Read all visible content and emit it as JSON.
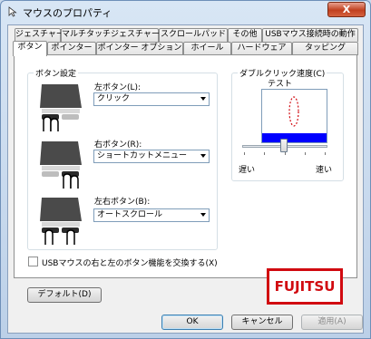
{
  "window": {
    "title": "マウスのプロパティ",
    "close_glyph": "X"
  },
  "tabs": {
    "row1": [
      "ジェスチャー",
      "マルチタッチジェスチャー",
      "スクロールパッド",
      "その他",
      "USBマウス接続時の動作"
    ],
    "row2": [
      "ボタン",
      "ポインター",
      "ポインター オプション",
      "ホイール",
      "ハードウェア",
      "タッピング"
    ],
    "active": "ボタン"
  },
  "button_settings": {
    "group_label": "ボタン設定",
    "left": {
      "label": "左ボタン(L):",
      "value": "クリック"
    },
    "right": {
      "label": "右ボタン(R):",
      "value": "ショートカットメニュー"
    },
    "both": {
      "label": "左右ボタン(B):",
      "value": "オートスクロール"
    }
  },
  "double_click": {
    "group_label": "ダブルクリック速度(C)",
    "test_label": "テスト",
    "slow_label": "遅い",
    "fast_label": "速い",
    "speed_level": 0.7
  },
  "swap_checkbox": {
    "label": "USBマウスの右と左のボタン機能を交換する(X)",
    "checked": false
  },
  "default_button": "デフォルト(D)",
  "logo_text": "FUJITSU",
  "footer": {
    "ok": "OK",
    "cancel": "キャンセル",
    "apply": "適用(A)"
  },
  "colors": {
    "logo_red": "#d10a10",
    "test_blue": "#0000ff"
  }
}
